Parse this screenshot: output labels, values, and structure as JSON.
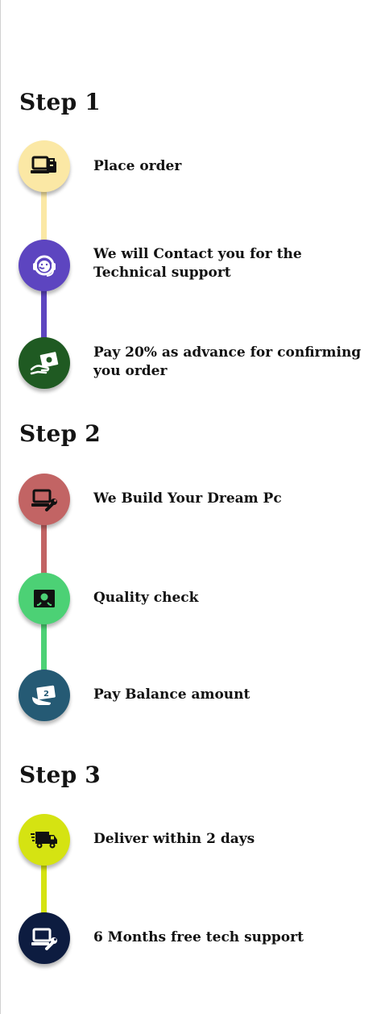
{
  "steps": [
    {
      "heading": "Step 1",
      "items": [
        {
          "label": "Place order",
          "icon": "laptop-bag-icon",
          "color": "#fbe8a5"
        },
        {
          "label": "We will Contact you for the Technical support",
          "icon": "support-headset-icon",
          "color": "#5d45c0"
        },
        {
          "label": "Pay 20%  as advance for confirming you order",
          "icon": "hand-cash-icon",
          "color": "#1f5a22"
        }
      ]
    },
    {
      "heading": "Step 2",
      "items": [
        {
          "label": "We Build Your Dream Pc",
          "icon": "laptop-wrench-icon",
          "color": "#c26464"
        },
        {
          "label": "Quality check",
          "icon": "quality-badge-icon",
          "color": "#4cd175"
        },
        {
          "label": "Pay Balance amount",
          "icon": "cash-hand-icon",
          "color": "#255a74"
        }
      ]
    },
    {
      "heading": "Step 3",
      "items": [
        {
          "label": "Deliver within 2 days",
          "icon": "delivery-truck-icon",
          "color": "#d5e312"
        },
        {
          "label": "6 Months free tech support",
          "icon": "laptop-wrench-icon",
          "color": "#0d1c40"
        }
      ]
    }
  ]
}
